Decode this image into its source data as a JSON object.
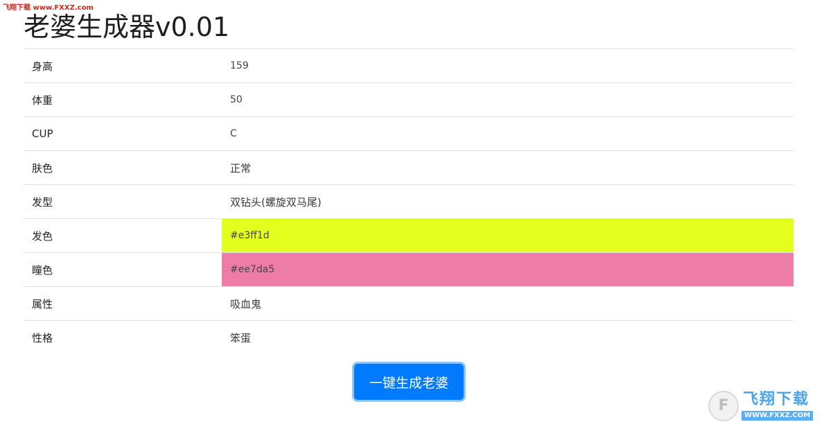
{
  "watermark_top": "飞翔下载 www.FXXZ.com",
  "title": "老婆生成器v0.01",
  "rows": [
    {
      "key": "身高",
      "value": "159",
      "bg": ""
    },
    {
      "key": "体重",
      "value": "50",
      "bg": ""
    },
    {
      "key": "CUP",
      "value": "C",
      "bg": ""
    },
    {
      "key": "肤色",
      "value": "正常",
      "bg": ""
    },
    {
      "key": "发型",
      "value": "双钻头(螺旋双马尾)",
      "bg": ""
    },
    {
      "key": "发色",
      "value": "#e3ff1d",
      "bg": "#e3ff1d"
    },
    {
      "key": "瞳色",
      "value": "#ee7da5",
      "bg": "#ee7da5"
    },
    {
      "key": "属性",
      "value": "吸血鬼",
      "bg": ""
    },
    {
      "key": "性格",
      "value": "笨蛋",
      "bg": ""
    }
  ],
  "generate_button": "一键生成老婆",
  "logo": {
    "text": "飞翔下载",
    "url": "WWW.FXXZ.COM"
  },
  "colors": {
    "button": "#007bff",
    "hair": "#e3ff1d",
    "eye": "#ee7da5"
  }
}
